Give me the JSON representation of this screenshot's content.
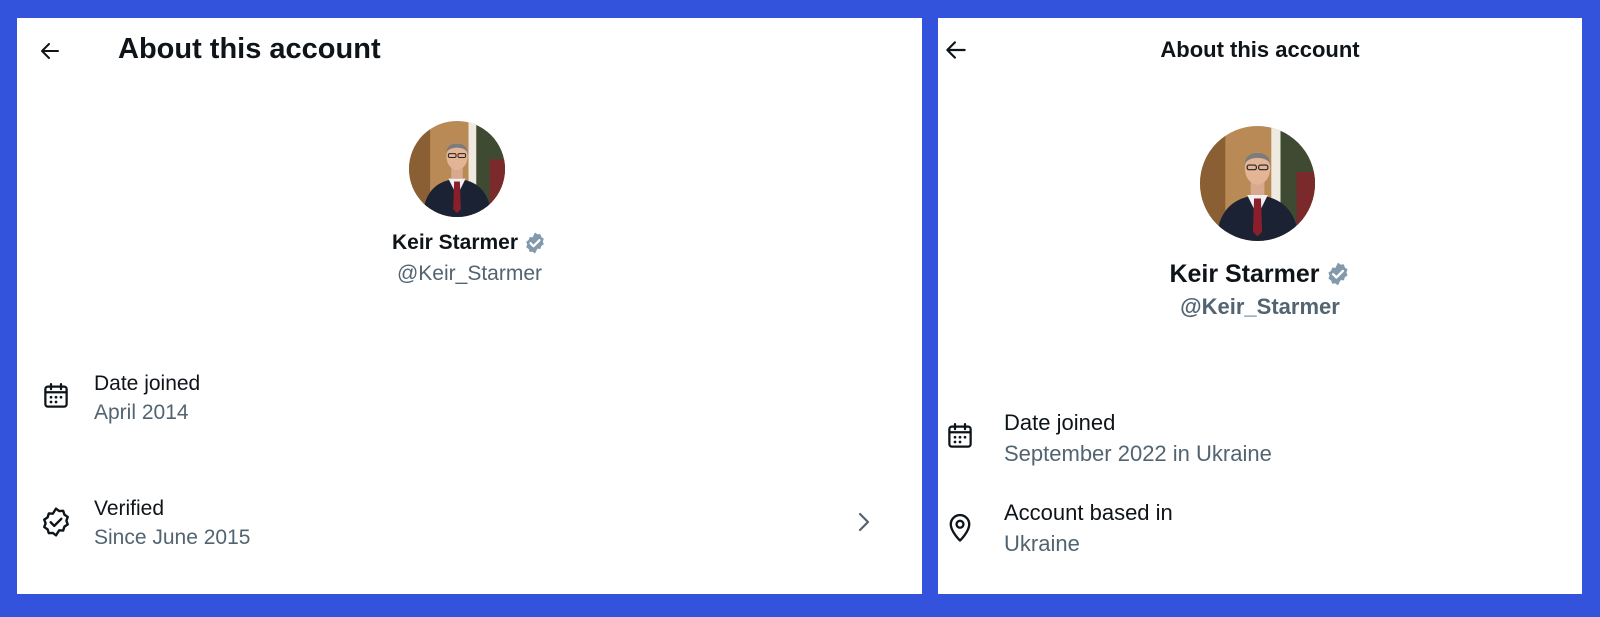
{
  "left_panel": {
    "title": "About this account",
    "profile": {
      "name": "Keir Starmer",
      "handle": "@Keir_Starmer"
    },
    "rows": [
      {
        "icon": "calendar-icon",
        "label": "Date joined",
        "value": "April 2014"
      },
      {
        "icon": "verified-badge-icon",
        "label": "Verified",
        "value": "Since June 2015"
      }
    ]
  },
  "right_panel": {
    "title": "About this account",
    "profile": {
      "name": "Keir Starmer",
      "handle": "@Keir_Starmer"
    },
    "rows": [
      {
        "icon": "calendar-icon",
        "label": "Date joined",
        "value": "September 2022 in Ukraine"
      },
      {
        "icon": "location-pin-icon",
        "label": "Account based in",
        "value": "Ukraine"
      }
    ]
  },
  "colors": {
    "background": "#3353dd",
    "panel": "#ffffff",
    "primary_text": "#0f1419",
    "secondary_text": "#536471",
    "verified_badge": "#829aab"
  }
}
